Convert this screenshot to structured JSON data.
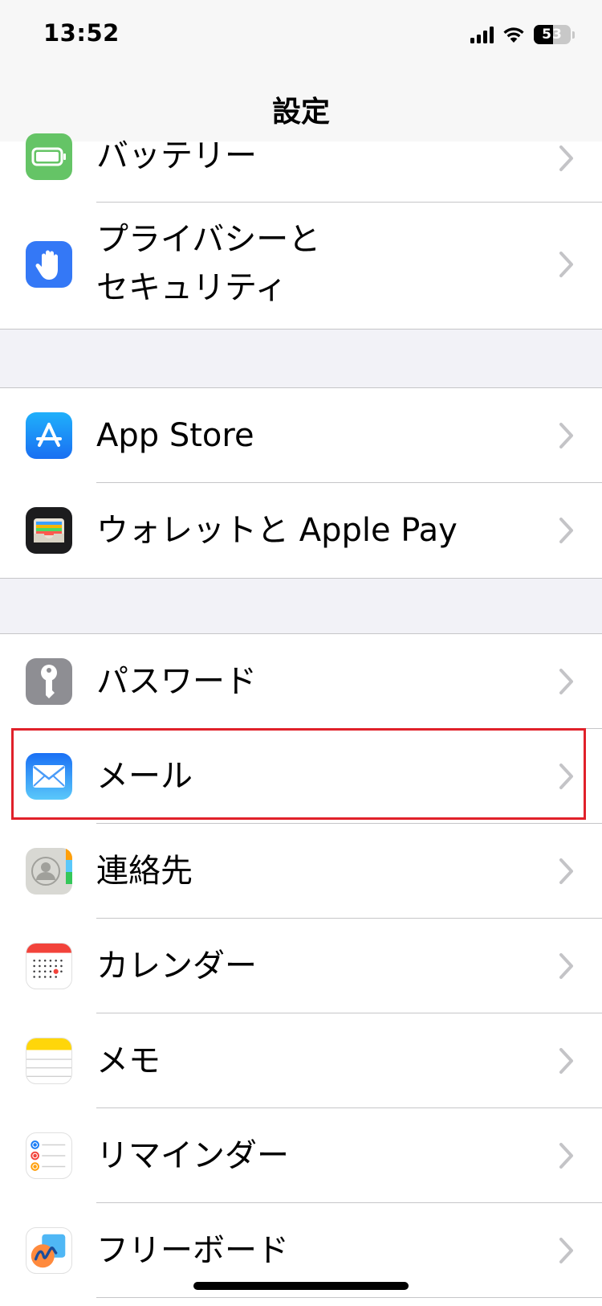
{
  "status_bar": {
    "time": "13:52",
    "battery_level": "53"
  },
  "nav": {
    "title": "設定"
  },
  "groups": [
    {
      "items": [
        {
          "label": "バッテリー",
          "icon": "battery-icon",
          "icon_color": "#65c466"
        },
        {
          "label_line1": "プライバシーと",
          "label_line2": "セキュリティ",
          "icon": "hand-icon",
          "icon_color": "#3478f6"
        }
      ]
    },
    {
      "items": [
        {
          "label": "App Store",
          "icon": "app-store-icon",
          "icon_color": "#1c8ef9"
        },
        {
          "label": "ウォレットと Apple Pay",
          "icon": "wallet-icon",
          "icon_color": "#1c1c1e"
        }
      ]
    },
    {
      "items": [
        {
          "label": "パスワード",
          "icon": "key-icon",
          "icon_color": "#8e8e93"
        },
        {
          "label": "メール",
          "icon": "mail-icon",
          "icon_color": "#1e90ff",
          "highlighted": true
        },
        {
          "label": "連絡先",
          "icon": "contacts-icon",
          "icon_color": "#d8d8d8"
        },
        {
          "label": "カレンダー",
          "icon": "calendar-icon",
          "icon_color": "#ffffff"
        },
        {
          "label": "メモ",
          "icon": "notes-icon",
          "icon_color": "#ffd60a"
        },
        {
          "label": "リマインダー",
          "icon": "reminders-icon",
          "icon_color": "#ffffff"
        },
        {
          "label": "フリーボード",
          "icon": "freeform-icon",
          "icon_color": "#ffffff"
        }
      ]
    }
  ],
  "colors": {
    "highlight": "#e0212a",
    "background": "#f2f2f7",
    "separator": "#c6c6c8",
    "chevron": "#c4c4c7"
  }
}
